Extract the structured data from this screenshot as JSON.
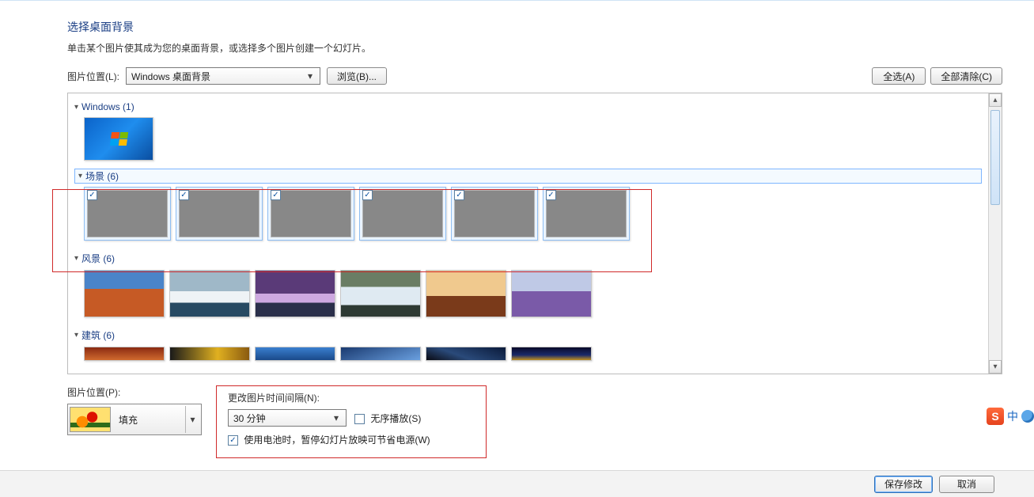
{
  "title": "选择桌面背景",
  "subtitle": "单击某个图片使其成为您的桌面背景，或选择多个图片创建一个幻灯片。",
  "location_label": "图片位置(L):",
  "location_value": "Windows 桌面背景",
  "browse_label": "浏览(B)...",
  "select_all_label": "全选(A)",
  "clear_all_label": "全部清除(C)",
  "groups": {
    "windows": {
      "label": "Windows (1)"
    },
    "scene": {
      "label": "场景 (6)"
    },
    "landscape": {
      "label": "风景 (6)"
    },
    "architecture": {
      "label": "建筑 (6)"
    }
  },
  "pic_position_label": "图片位置(P):",
  "pic_position_value": "填充",
  "interval_label": "更改图片时间间隔(N):",
  "interval_value": "30 分钟",
  "shuffle_label": "无序播放(S)",
  "battery_label": "使用电池时，暂停幻灯片放映可节省电源(W)",
  "save_label": "保存修改",
  "cancel_label": "取消",
  "ime_text": "中",
  "checkmark": "✓",
  "tri": "▾",
  "tri_small": "▸"
}
